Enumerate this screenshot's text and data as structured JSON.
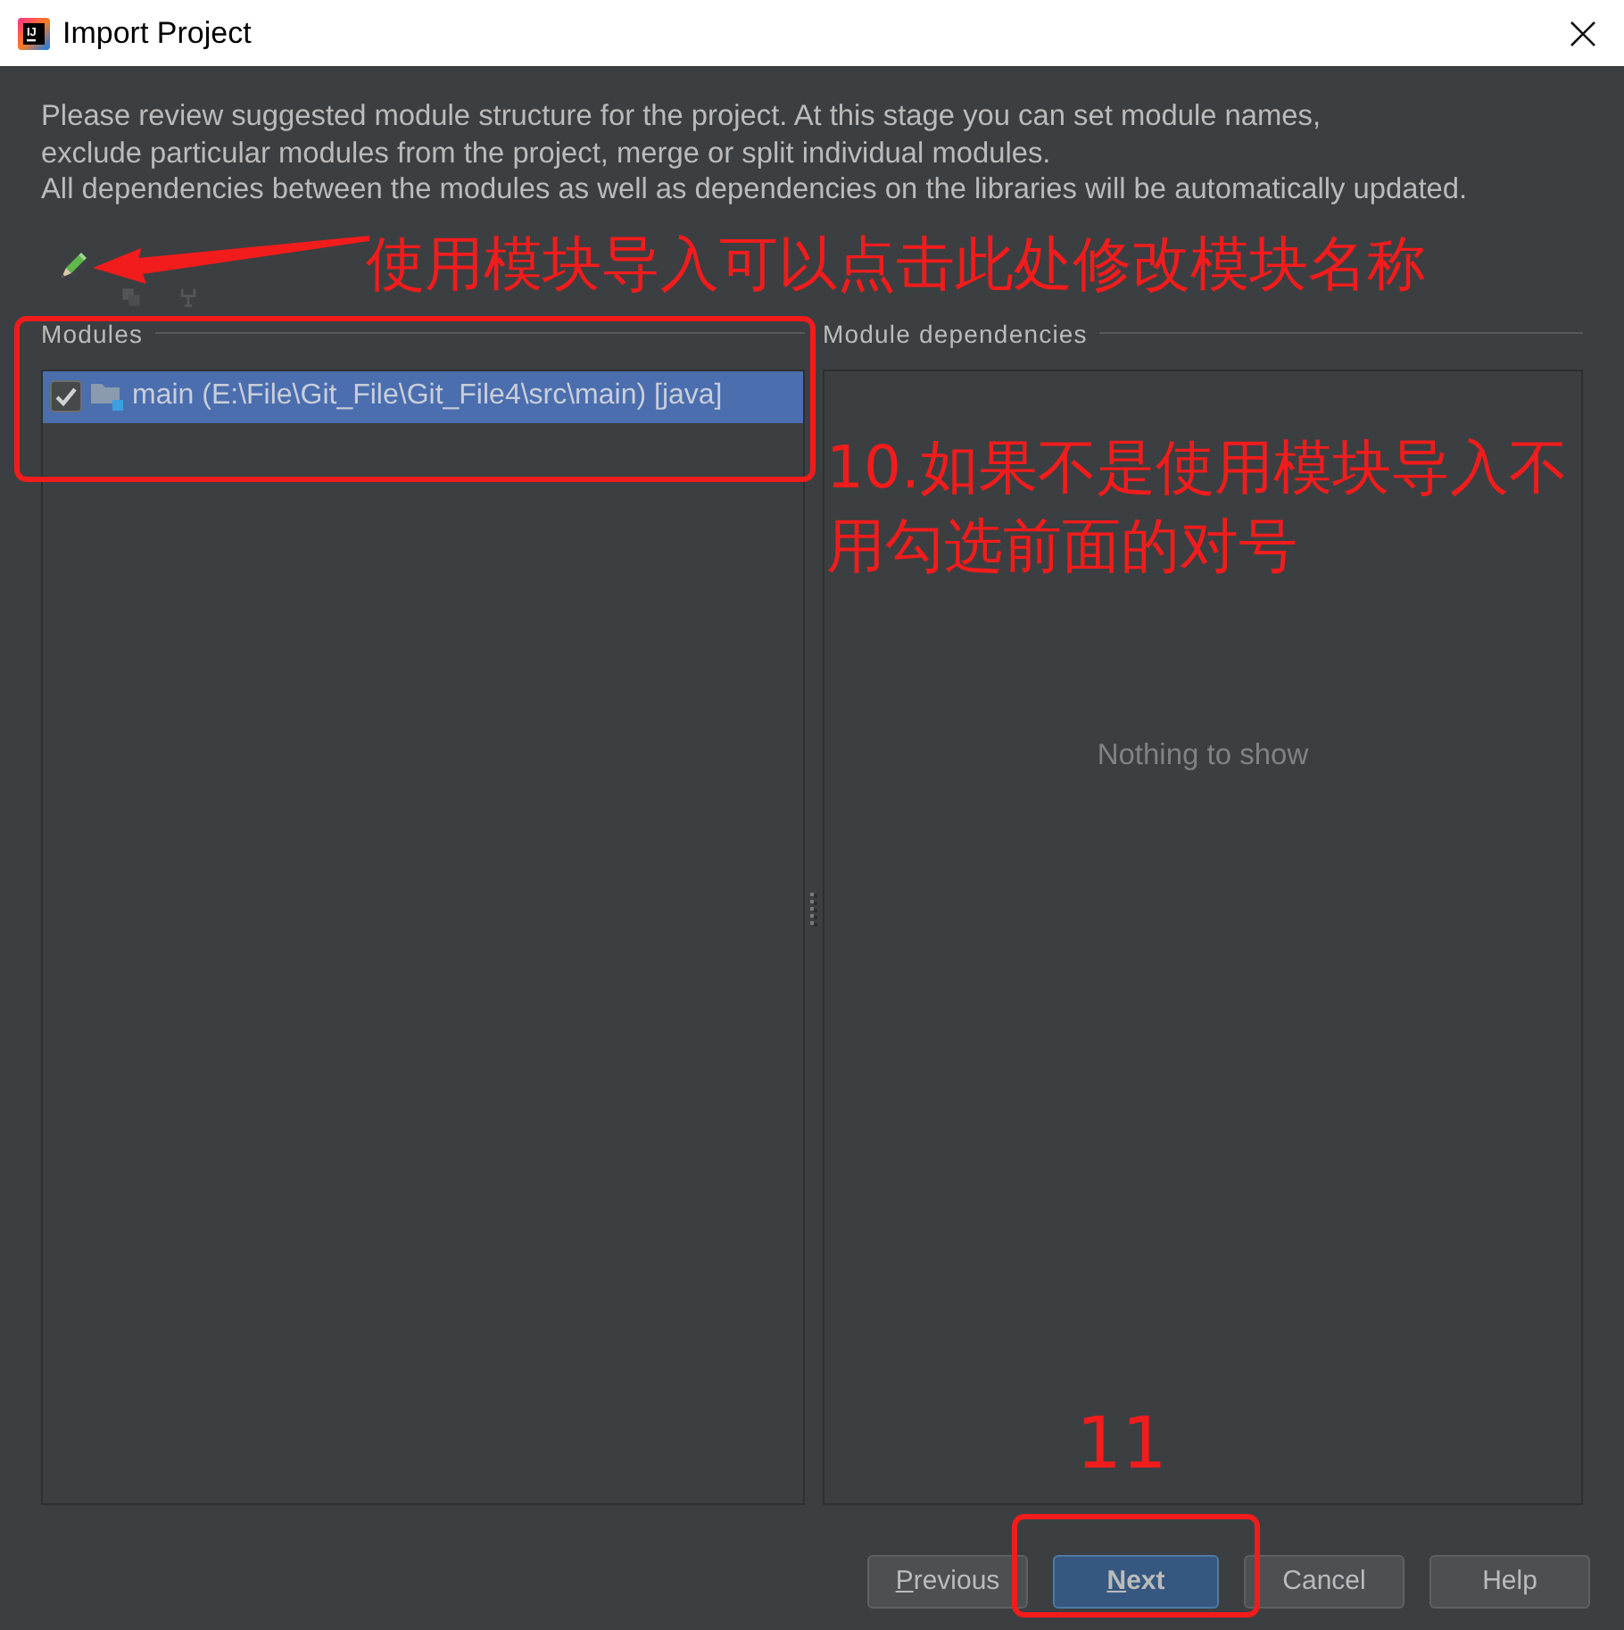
{
  "window": {
    "title": "Import Project",
    "icon_text": "IJ"
  },
  "description": [
    "Please review suggested module structure for the project. At this stage you can set module names,",
    "exclude particular modules from the project, merge or split individual modules.",
    "All dependencies between the modules as well as dependencies on the libraries will be automatically updated."
  ],
  "toolbar": [
    {
      "kind": "pencil",
      "disabled": false
    },
    {
      "kind": "squares",
      "disabled": true
    },
    {
      "kind": "fork",
      "disabled": true
    }
  ],
  "modules": {
    "heading": "Modules",
    "items": [
      {
        "label": "main (E:\\File\\Git_File\\Git_File4\\src\\main) [java]",
        "checked": true,
        "selected": true
      }
    ]
  },
  "dependencies": {
    "heading": "Module dependencies",
    "empty_text": "Nothing to show"
  },
  "buttons": [
    {
      "label": "Previous",
      "mnemonic": true,
      "default": false
    },
    {
      "label": "Next",
      "mnemonic": true,
      "default": true
    },
    {
      "label": "Cancel",
      "mnemonic": false,
      "default": false
    },
    {
      "label": "Help",
      "mnemonic": false,
      "default": false
    }
  ],
  "annotations": [
    {
      "kind": "arrow",
      "text": "使用模块导入可以点击此处修改模块名称"
    },
    {
      "kind": "frame",
      "text": "10.如果不是使用模块导入不用勾选前面的对号"
    },
    {
      "kind": "frame",
      "text": "11"
    }
  ]
}
